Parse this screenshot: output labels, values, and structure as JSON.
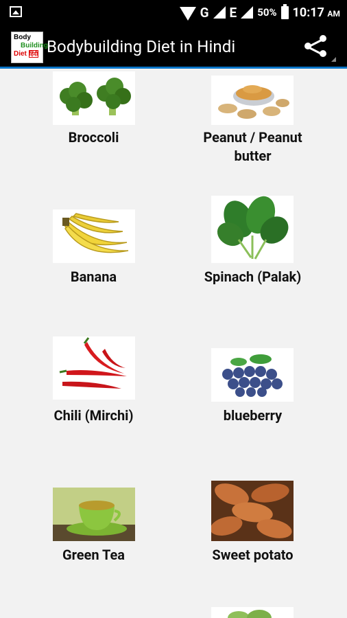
{
  "status_bar": {
    "network": "G",
    "network2": "E",
    "battery": "50%",
    "time": "10:17",
    "ampm": "AM"
  },
  "app_bar": {
    "logo_line1": "Body",
    "logo_line2": "Building",
    "logo_line3": "Diet",
    "logo_hindi": "हिंदी",
    "title": "Bodybuilding Diet in Hindi"
  },
  "foods": [
    {
      "label": "Broccoli",
      "icon": "broccoli-image"
    },
    {
      "label": "Peanut / Peanut butter",
      "icon": "peanut-butter-image"
    },
    {
      "label": "Banana",
      "icon": "banana-image"
    },
    {
      "label": "Spinach (Palak)",
      "icon": "spinach-image"
    },
    {
      "label": "Chili (Mirchi)",
      "icon": "chili-image"
    },
    {
      "label": "blueberry",
      "icon": "blueberry-image"
    },
    {
      "label": "Green Tea",
      "icon": "green-tea-image"
    },
    {
      "label": "Sweet potato",
      "icon": "sweet-potato-image"
    }
  ]
}
